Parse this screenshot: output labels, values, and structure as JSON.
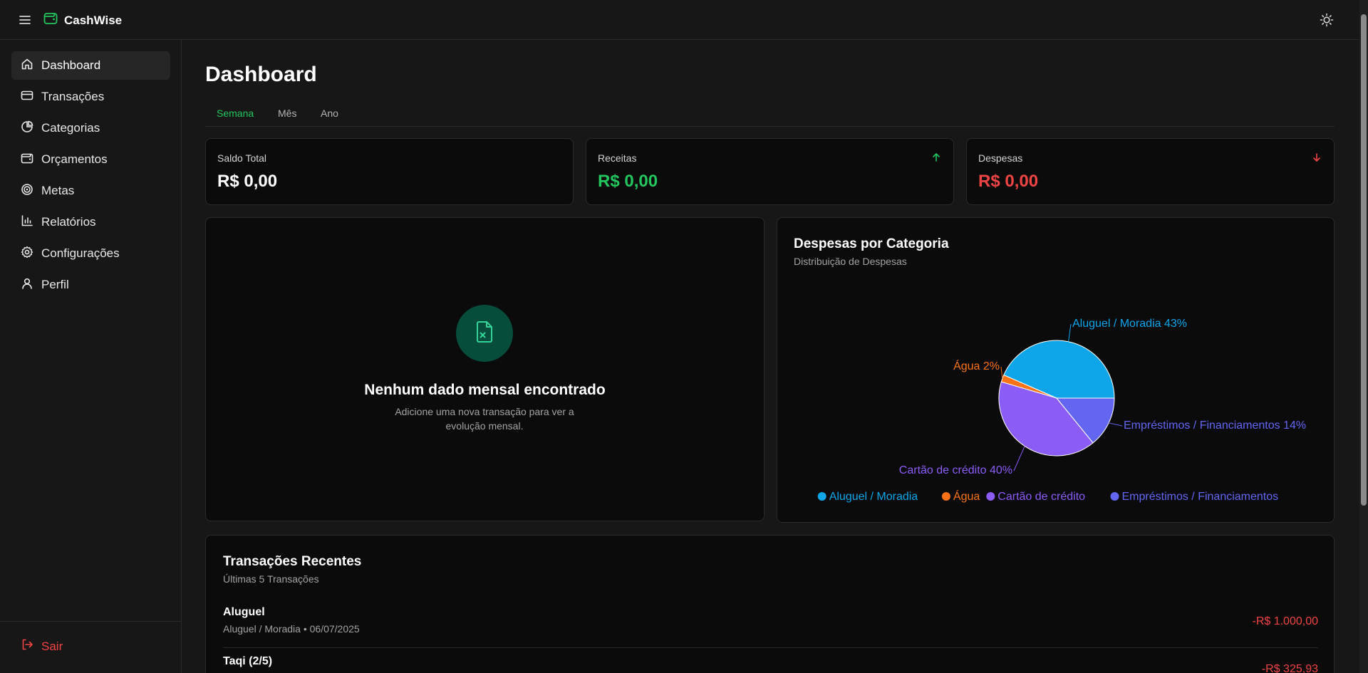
{
  "header": {
    "app_name": "CashWise"
  },
  "sidebar": {
    "items": [
      {
        "label": "Dashboard",
        "icon": "home-icon",
        "active": true
      },
      {
        "label": "Transações",
        "icon": "credit-card-icon"
      },
      {
        "label": "Categorias",
        "icon": "pie-chart-icon"
      },
      {
        "label": "Orçamentos",
        "icon": "wallet-icon"
      },
      {
        "label": "Metas",
        "icon": "target-icon"
      },
      {
        "label": "Relatórios",
        "icon": "bar-chart-icon"
      },
      {
        "label": "Configurações",
        "icon": "gear-icon"
      },
      {
        "label": "Perfil",
        "icon": "user-icon"
      }
    ],
    "logout_label": "Sair"
  },
  "main": {
    "title": "Dashboard",
    "tabs": [
      {
        "label": "Semana",
        "active": true
      },
      {
        "label": "Mês"
      },
      {
        "label": "Ano"
      }
    ],
    "stats": [
      {
        "label": "Saldo Total",
        "value": "R$ 0,00",
        "color": "#ffffff"
      },
      {
        "label": "Receitas",
        "value": "R$ 0,00",
        "color": "#22c55e",
        "icon": "arrow-up-icon"
      },
      {
        "label": "Despesas",
        "value": "R$ 0,00",
        "color": "#ef4444",
        "icon": "arrow-down-icon"
      }
    ],
    "empty_state": {
      "icon": "file-x-icon",
      "title": "Nenhum dado mensal encontrado",
      "subtitle": "Adicione uma nova transação para ver a evolução mensal."
    },
    "expenses_chart": {
      "title": "Despesas por Categoria",
      "subtitle": "Distribuição de Despesas"
    },
    "recent": {
      "title": "Transações Recentes",
      "subtitle": "Últimas 5 Transações",
      "items": [
        {
          "name": "Aluguel",
          "meta": "Aluguel / Moradia • 06/07/2025",
          "amount": "-R$ 1.000,00"
        },
        {
          "name": "Taqi (2/5)",
          "meta": "",
          "amount": "-R$ 325,93"
        }
      ]
    }
  },
  "chart_data": {
    "type": "pie",
    "slices": [
      {
        "name": "Aluguel / Moradia",
        "value": 43,
        "label": "Aluguel / Moradia 43%",
        "color": "#0ea5e9"
      },
      {
        "name": "Água",
        "value": 2,
        "label": "Água 2%",
        "color": "#f97316"
      },
      {
        "name": "Cartão de crédito",
        "value": 40,
        "label": "Cartão de crédito 40%",
        "color": "#8b5cf6"
      },
      {
        "name": "Empréstimos / Financiamentos",
        "value": 14,
        "label": "Empréstimos / Financiamentos 14%",
        "color": "#6366f1"
      }
    ],
    "title": "Despesas por Categoria",
    "legend": "bottom"
  }
}
